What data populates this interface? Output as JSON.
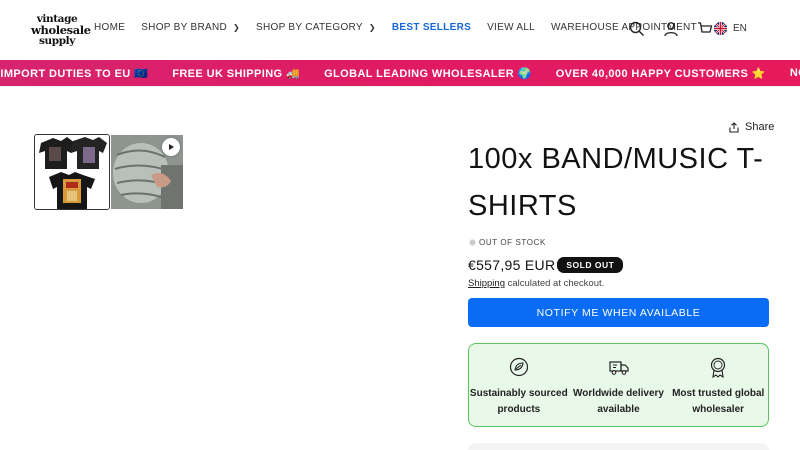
{
  "logo": {
    "line1": "vintage",
    "line2": "wholesale",
    "line3": "supply"
  },
  "nav": [
    {
      "label": "HOME",
      "has_dropdown": false,
      "active": false
    },
    {
      "label": "SHOP BY BRAND",
      "has_dropdown": true,
      "active": false
    },
    {
      "label": "SHOP BY CATEGORY",
      "has_dropdown": true,
      "active": false
    },
    {
      "label": "BEST SELLERS",
      "has_dropdown": false,
      "active": true
    },
    {
      "label": "VIEW ALL",
      "has_dropdown": false,
      "active": false
    },
    {
      "label": "WAREHOUSE APPOINTMENT",
      "has_dropdown": false,
      "active": false
    }
  ],
  "header_icons": [
    "search-icon",
    "account-icon",
    "cart-icon"
  ],
  "language": {
    "code": "EN",
    "flag": "uk-flag-icon"
  },
  "marquee": {
    "items": [
      "O IMPORT DUTIES TO EU 🇪🇺",
      "FREE UK SHIPPING 🚚",
      "GLOBAL LEADING WHOLESALER 🌍",
      "OVER 40,000 HAPPY CUSTOMERS ⭐",
      "NO IMPORT DUTIES TO EU"
    ]
  },
  "product": {
    "share_label": "Share",
    "title": "100x BAND/MUSIC T-SHIRTS",
    "stock_status": "OUT OF STOCK",
    "price": "€557,95 EUR",
    "badge": "SOLD OUT",
    "shipping_link": "Shipping",
    "shipping_text": " calculated at checkout.",
    "notify_label": "NOTIFY ME WHEN AVAILABLE"
  },
  "features": [
    {
      "icon": "sustainable-icon",
      "line1": "Sustainably sourced",
      "line2": "products"
    },
    {
      "icon": "delivery-truck-icon",
      "line1": "Worldwide delivery",
      "line2": "available"
    },
    {
      "icon": "award-badge-icon",
      "line1": "Most trusted global",
      "line2": "wholesaler"
    }
  ],
  "colors": {
    "accent": "#0a6cf5",
    "nav_active": "#1668d6",
    "marquee": "#e01a63",
    "feature_bg": "#e8f8e9",
    "feature_border": "#5cc45f"
  }
}
